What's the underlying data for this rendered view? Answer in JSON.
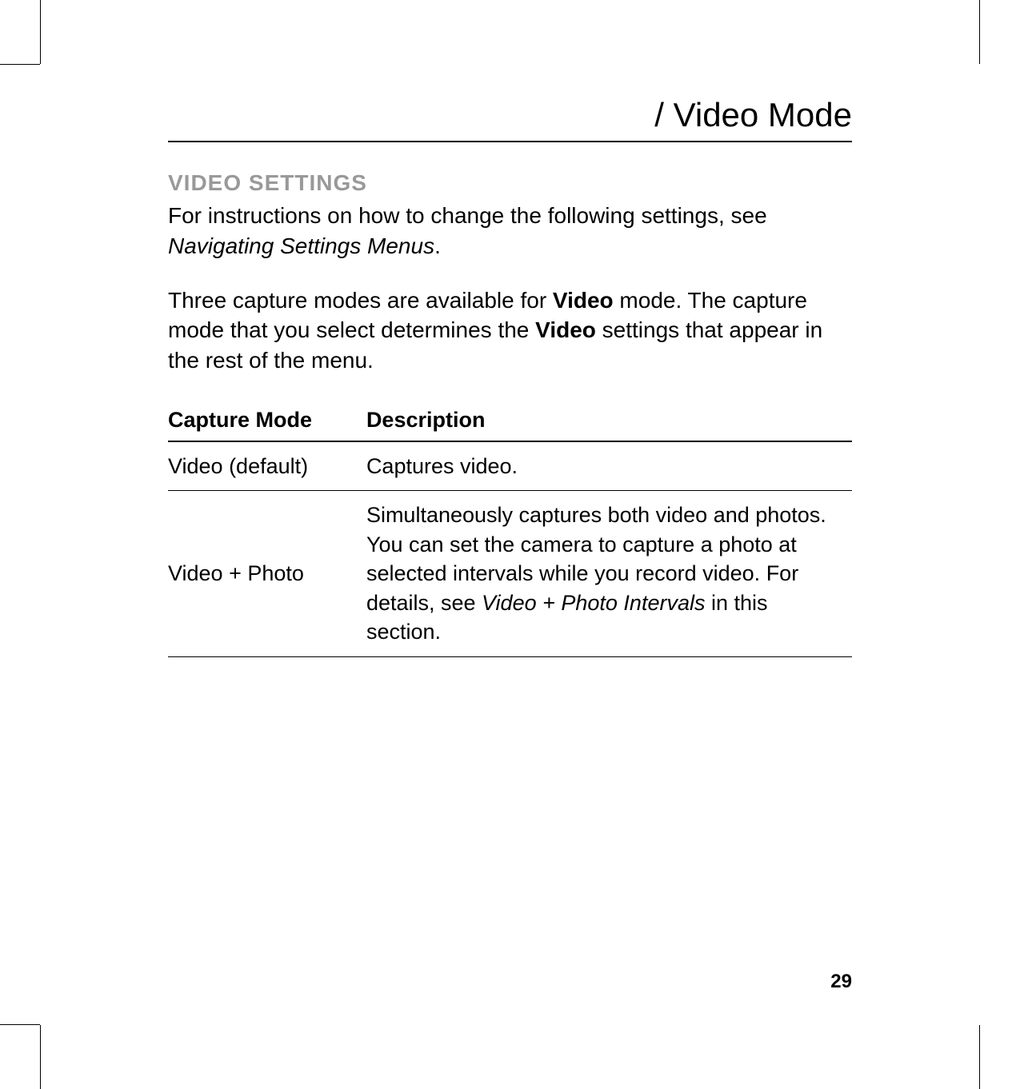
{
  "chapter_title": "/ Video Mode",
  "section_heading": "VIDEO SETTINGS",
  "intro_text_1": "For instructions on how to change the following settings, see ",
  "intro_italic_1": "Navigating Settings Menus",
  "intro_period_1": ".",
  "para2_part1": "Three capture modes are available for ",
  "para2_bold1": "Video",
  "para2_part2": " mode. The capture mode that you select determines the ",
  "para2_bold2": "Video",
  "para2_part3": " settings that appear in the rest of the menu.",
  "table": {
    "headers": [
      "Capture Mode",
      "Description"
    ],
    "rows": [
      {
        "mode": "Video (default)",
        "desc": "Captures video."
      },
      {
        "mode": "Video + Photo",
        "desc_part1": "Simultaneously captures both video and photos. You can set the camera to capture a photo at selected intervals while you record video. For details, see ",
        "desc_italic": "Video + Photo Intervals",
        "desc_part2": " in this section."
      }
    ]
  },
  "page_number": "29"
}
